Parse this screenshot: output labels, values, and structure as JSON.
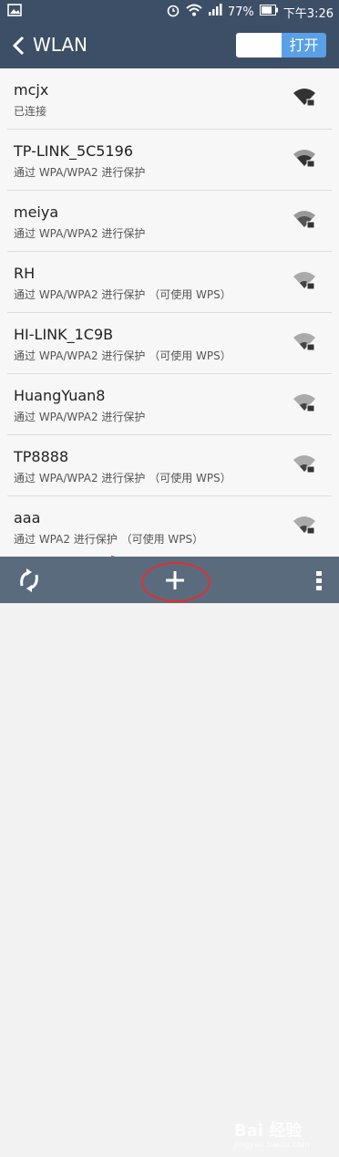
{
  "statusbar": {
    "battery": "77%",
    "time": "下午3:26"
  },
  "appbar": {
    "title": "WLAN",
    "toggle_label": "打开"
  },
  "networks": [
    {
      "name": "mcjx",
      "status": "已连接"
    },
    {
      "name": "TP-LINK_5C5196",
      "status": "通过 WPA/WPA2 进行保护"
    },
    {
      "name": "meiya",
      "status": "通过 WPA/WPA2 进行保护"
    },
    {
      "name": "RH",
      "status": "通过 WPA/WPA2 进行保护 （可使用 WPS）"
    },
    {
      "name": "HI-LINK_1C9B",
      "status": "通过 WPA/WPA2 进行保护 （可使用 WPS）"
    },
    {
      "name": "HuangYuan8",
      "status": "通过 WPA/WPA2 进行保护"
    },
    {
      "name": "TP8888",
      "status": "通过 WPA/WPA2 进行保护 （可使用 WPS）"
    },
    {
      "name": "aaa",
      "status": "通过 WPA2 进行保护 （可使用 WPS）"
    }
  ],
  "watermark": {
    "brand": "Bai 经验",
    "url": "jingyan.baidu.com"
  },
  "colors": {
    "header": "#3d4f66",
    "toggle_on": "#5aa0e6",
    "bottom": "#5b6b7e",
    "annotation": "#e03030"
  }
}
